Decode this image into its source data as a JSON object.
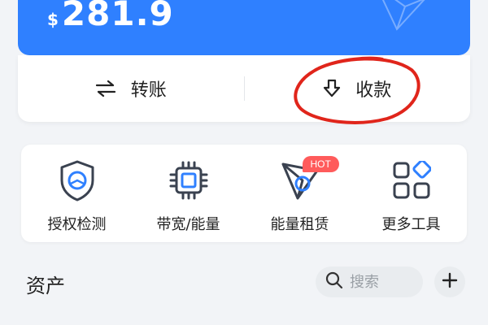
{
  "balance": {
    "currency_symbol": "$",
    "amount": "281.9"
  },
  "actions": {
    "transfer_label": "转账",
    "receive_label": "收款"
  },
  "tools": [
    {
      "label": "授权检测",
      "icon": "shield-icon"
    },
    {
      "label": "带宽/能量",
      "icon": "chip-icon"
    },
    {
      "label": "能量租赁",
      "icon": "paper-plane-icon",
      "badge": "HOT"
    },
    {
      "label": "更多工具",
      "icon": "grid-icon"
    }
  ],
  "assets": {
    "title": "资产",
    "search_placeholder": "搜索"
  },
  "colors": {
    "brand_blue": "#2f80ff",
    "hot_red": "#ff5b5b",
    "annotation_red": "#e0251b"
  }
}
